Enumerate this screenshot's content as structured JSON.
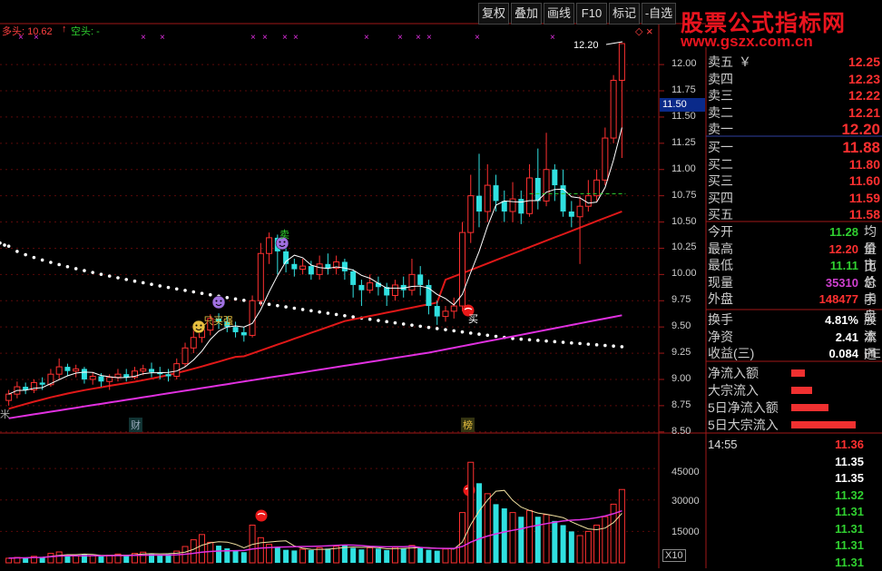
{
  "toolbar": {
    "buttons": [
      "复权",
      "叠加",
      "画线",
      "F10",
      "标记",
      "-自选"
    ]
  },
  "header": {
    "long_label": "多头: 10.62",
    "long_arrow": "↑",
    "short_label": "空头: -",
    "top_icon": "◇",
    "close_label": "×"
  },
  "watermark": {
    "title": "股票公式指标网",
    "url": "www.gszx.com.cn"
  },
  "price_axis": {
    "ticks": [
      "12.00",
      "11.75",
      "11.50",
      "11.25",
      "11.00",
      "10.75",
      "10.50",
      "10.25",
      "10.00",
      "9.75",
      "9.50",
      "9.25",
      "9.00",
      "8.75",
      "8.50"
    ],
    "current": "11.50",
    "peak_label": "12.20"
  },
  "volume_axis": {
    "ticks": [
      "45000",
      "30000",
      "15000"
    ],
    "unit": "X10"
  },
  "markers": {
    "cai": "财",
    "bang": "榜",
    "buy": "买",
    "sell": "卖",
    "strong_buy": "只买强",
    "left_edge": "米"
  },
  "quotes": {
    "sell": [
      {
        "label": "卖五",
        "suffix": "￥",
        "value": "12.25"
      },
      {
        "label": "卖四",
        "suffix": "",
        "value": "12.23"
      },
      {
        "label": "卖三",
        "suffix": "",
        "value": "12.22"
      },
      {
        "label": "卖二",
        "suffix": "",
        "value": "12.21"
      },
      {
        "label": "卖一",
        "suffix": "",
        "value": "12.20"
      }
    ],
    "buy": [
      {
        "label": "买一",
        "value": "11.88"
      },
      {
        "label": "买二",
        "value": "11.80"
      },
      {
        "label": "买三",
        "value": "11.60"
      },
      {
        "label": "买四",
        "value": "11.59"
      },
      {
        "label": "买五",
        "value": "11.58"
      }
    ]
  },
  "stats": [
    {
      "label": "今开",
      "value": "11.28",
      "right": "均价",
      "color": "#30d030"
    },
    {
      "label": "最高",
      "value": "12.20",
      "right": "量比",
      "color": "#ff3030"
    },
    {
      "label": "最低",
      "value": "11.11",
      "right": "市价",
      "color": "#30d030"
    },
    {
      "label": "现量",
      "value": "35310",
      "right": "总手",
      "color": "#d040d0"
    },
    {
      "label": "外盘",
      "value": "148477",
      "right": "内盘",
      "color": "#ff3030"
    }
  ],
  "stats2": [
    {
      "label": "换手",
      "value": "4.81%",
      "right": "股本",
      "color": "#ffffff"
    },
    {
      "label": "净资",
      "value": "2.41",
      "right": "流通",
      "color": "#ffffff"
    },
    {
      "label": "收益(三)",
      "value": "0.084",
      "right": "PE",
      "color": "#ffffff"
    }
  ],
  "fund_flow": [
    {
      "label": "净流入额",
      "bar": 0.2
    },
    {
      "label": "大宗流入",
      "bar": 0.3
    },
    {
      "label": "5日净流入额",
      "bar": 0.55
    },
    {
      "label": "5日大宗流入",
      "bar": 0.95
    }
  ],
  "ticks": [
    {
      "time": "14:55",
      "price": "11.36",
      "color": "#ff3030"
    },
    {
      "time": "",
      "price": "11.35",
      "color": "#ffffff"
    },
    {
      "time": "",
      "price": "11.35",
      "color": "#ffffff"
    },
    {
      "time": "",
      "price": "11.32",
      "color": "#30d030"
    },
    {
      "time": "",
      "price": "11.31",
      "color": "#30d030"
    },
    {
      "time": "",
      "price": "11.31",
      "color": "#30d030"
    },
    {
      "time": "",
      "price": "11.31",
      "color": "#30d030"
    },
    {
      "time": "",
      "price": "11.31",
      "color": "#30d030"
    }
  ],
  "chart_data": {
    "type": "candlestick",
    "price_range": [
      8.5,
      12.1
    ],
    "volume_range": [
      0,
      52000
    ],
    "candles": [
      [
        8.8,
        8.86,
        8.75,
        8.9
      ],
      [
        8.86,
        8.93,
        8.82,
        8.98
      ],
      [
        8.93,
        8.9,
        8.86,
        8.97
      ],
      [
        8.9,
        8.97,
        8.87,
        9.0
      ],
      [
        8.97,
        8.95,
        8.9,
        9.02
      ],
      [
        8.95,
        9.05,
        8.93,
        9.1
      ],
      [
        9.05,
        9.12,
        9.0,
        9.2
      ],
      [
        9.12,
        9.08,
        9.03,
        9.15
      ],
      [
        9.08,
        9.1,
        9.02,
        9.14
      ],
      [
        9.1,
        9.0,
        8.96,
        9.12
      ],
      [
        9.0,
        9.03,
        8.95,
        9.07
      ],
      [
        9.03,
        8.98,
        8.93,
        9.06
      ],
      [
        8.98,
        9.02,
        8.9,
        9.05
      ],
      [
        9.02,
        9.05,
        8.98,
        9.1
      ],
      [
        9.05,
        9.02,
        8.98,
        9.1
      ],
      [
        9.02,
        9.08,
        9.0,
        9.12
      ],
      [
        9.08,
        9.1,
        9.04,
        9.14
      ],
      [
        9.1,
        9.07,
        9.02,
        9.16
      ],
      [
        9.07,
        9.05,
        9.0,
        9.12
      ],
      [
        9.05,
        9.03,
        8.98,
        9.1
      ],
      [
        9.03,
        9.15,
        9.0,
        9.2
      ],
      [
        9.15,
        9.3,
        9.12,
        9.35
      ],
      [
        9.3,
        9.4,
        9.25,
        9.48
      ],
      [
        9.4,
        9.47,
        9.35,
        9.55
      ],
      [
        9.47,
        9.58,
        9.42,
        9.62
      ],
      [
        9.58,
        9.55,
        9.48,
        9.63
      ],
      [
        9.55,
        9.5,
        9.45,
        9.6
      ],
      [
        9.5,
        9.45,
        9.4,
        9.55
      ],
      [
        9.45,
        9.42,
        9.36,
        9.5
      ],
      [
        9.42,
        9.75,
        9.4,
        9.8
      ],
      [
        9.75,
        10.2,
        9.7,
        10.3
      ],
      [
        10.2,
        10.35,
        10.1,
        10.4
      ],
      [
        10.35,
        10.22,
        10.0,
        10.38
      ],
      [
        10.22,
        10.1,
        10.02,
        10.25
      ],
      [
        10.1,
        10.05,
        9.98,
        10.15
      ],
      [
        10.05,
        10.08,
        10.0,
        10.15
      ],
      [
        10.08,
        10.0,
        9.95,
        10.13
      ],
      [
        10.0,
        10.1,
        9.95,
        10.18
      ],
      [
        10.1,
        10.06,
        10.0,
        10.2
      ],
      [
        10.06,
        10.12,
        10.0,
        10.18
      ],
      [
        10.12,
        10.03,
        9.95,
        10.15
      ],
      [
        10.03,
        9.9,
        9.78,
        10.05
      ],
      [
        9.9,
        9.85,
        9.7,
        9.95
      ],
      [
        9.85,
        9.92,
        9.82,
        10.0
      ],
      [
        9.92,
        9.88,
        9.8,
        9.98
      ],
      [
        9.88,
        9.8,
        9.7,
        9.92
      ],
      [
        9.8,
        9.9,
        9.75,
        9.95
      ],
      [
        9.9,
        9.85,
        9.78,
        9.98
      ],
      [
        9.85,
        10.0,
        9.8,
        10.15
      ],
      [
        10.0,
        9.9,
        9.8,
        10.08
      ],
      [
        9.9,
        9.7,
        9.62,
        9.95
      ],
      [
        9.7,
        9.6,
        9.52,
        9.75
      ],
      [
        9.6,
        9.65,
        9.55,
        9.7
      ],
      [
        9.65,
        9.7,
        9.58,
        9.78
      ],
      [
        9.7,
        10.4,
        9.65,
        10.5
      ],
      [
        10.4,
        10.75,
        10.3,
        10.95
      ],
      [
        10.75,
        10.6,
        10.45,
        11.15
      ],
      [
        10.6,
        10.85,
        10.5,
        11.05
      ],
      [
        10.85,
        10.7,
        10.6,
        10.95
      ],
      [
        10.7,
        10.6,
        10.5,
        10.8
      ],
      [
        10.6,
        10.72,
        10.5,
        10.88
      ],
      [
        10.72,
        10.58,
        10.48,
        10.8
      ],
      [
        10.58,
        10.92,
        10.55,
        11.05
      ],
      [
        10.92,
        10.7,
        10.62,
        11.2
      ],
      [
        10.7,
        11.0,
        10.65,
        11.35
      ],
      [
        11.0,
        10.85,
        10.7,
        11.05
      ],
      [
        10.85,
        10.6,
        10.55,
        11.0
      ],
      [
        10.6,
        10.55,
        10.45,
        10.7
      ],
      [
        10.55,
        10.65,
        10.1,
        10.75
      ],
      [
        10.65,
        10.75,
        10.6,
        10.9
      ],
      [
        10.75,
        10.9,
        10.7,
        11.0
      ],
      [
        10.9,
        11.3,
        10.85,
        11.4
      ],
      [
        11.3,
        11.85,
        11.25,
        11.9
      ],
      [
        11.85,
        12.2,
        11.11,
        12.2
      ]
    ],
    "volumes": [
      2200,
      2600,
      2400,
      3100,
      2800,
      4500,
      5200,
      3800,
      3300,
      4100,
      3500,
      3200,
      3600,
      4200,
      3800,
      4500,
      5100,
      4300,
      3700,
      4200,
      5600,
      7800,
      11000,
      13500,
      9800,
      8200,
      6900,
      5800,
      5100,
      18000,
      12000,
      8800,
      7500,
      6200,
      5900,
      6500,
      6100,
      7200,
      6800,
      7900,
      8600,
      7100,
      6400,
      7200,
      6800,
      6100,
      7400,
      6900,
      8300,
      7500,
      6200,
      5800,
      6600,
      6900,
      24000,
      48000,
      38000,
      33000,
      28000,
      26000,
      24000,
      22000,
      25000,
      22000,
      23000,
      20000,
      18000,
      15000,
      13000,
      15000,
      18000,
      22000,
      28000,
      35000
    ]
  }
}
